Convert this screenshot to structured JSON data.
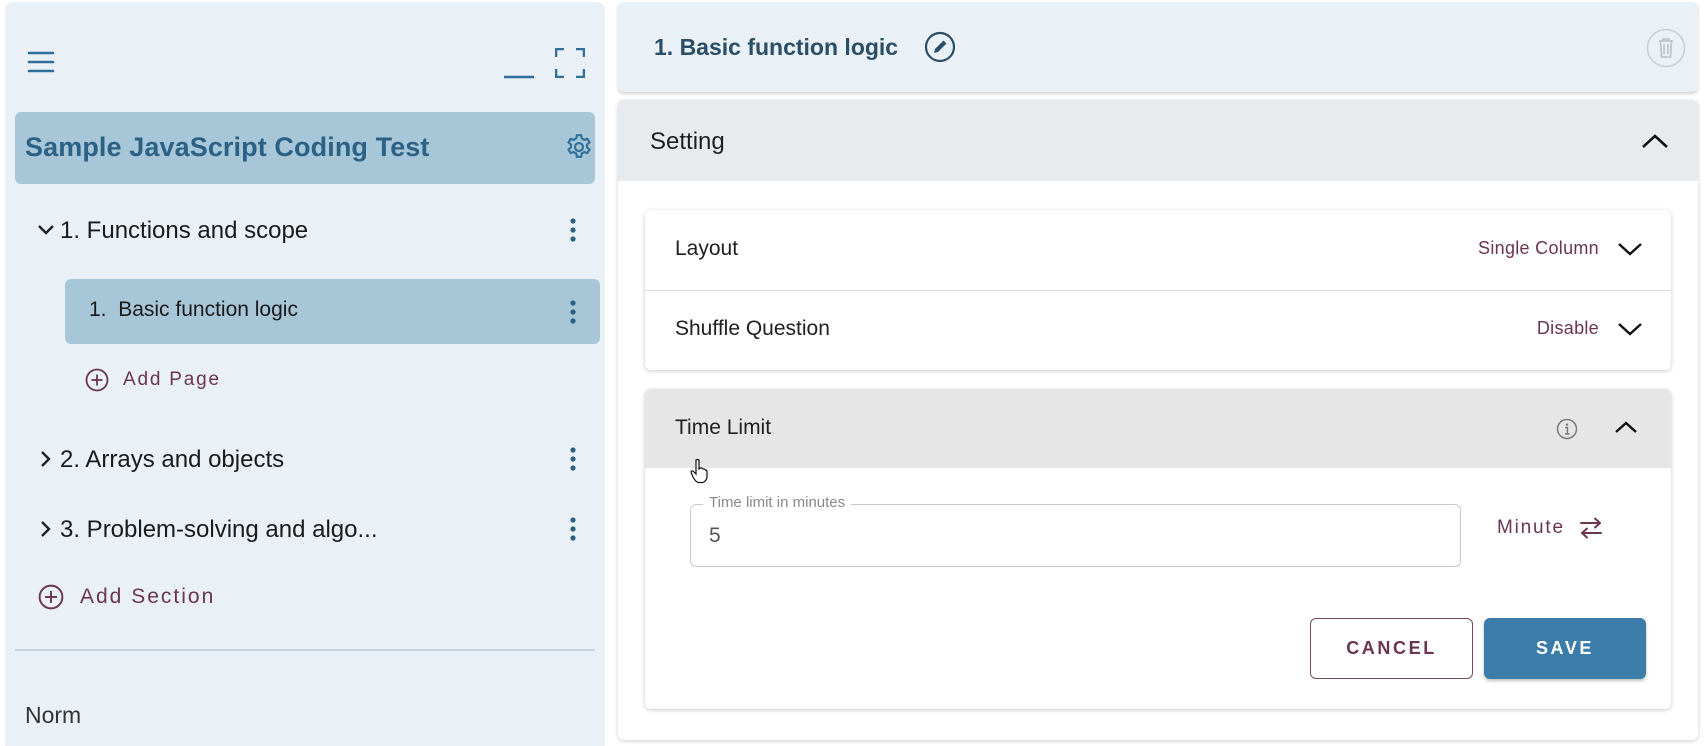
{
  "sidebar": {
    "test_title": "Sample JavaScript Coding Test",
    "sections": [
      {
        "label": "1. Functions and scope",
        "expanded": true
      },
      {
        "label": "2. Arrays and objects",
        "expanded": false
      },
      {
        "label": "3. Problem-solving and algo...",
        "expanded": false
      }
    ],
    "pages": [
      {
        "number": "1.",
        "label": "Basic function logic",
        "selected": true
      }
    ],
    "add_page_label": "Add Page",
    "add_section_label": "Add Section",
    "footer_text": "Norm"
  },
  "page": {
    "title": "1. Basic function logic"
  },
  "setting": {
    "title": "Setting",
    "options": [
      {
        "label": "Layout",
        "value": "Single Column"
      },
      {
        "label": "Shuffle Question",
        "value": "Disable"
      }
    ],
    "time_limit": {
      "label": "Time Limit",
      "field_label": "Time limit in minutes",
      "field_value": "5",
      "unit_label": "Minute"
    },
    "cancel_label": "CANCEL",
    "save_label": "SAVE"
  },
  "colors": {
    "accent": "#3b7ca8",
    "sidebar_bg": "#eaf1f6",
    "selected_bg": "#a7c6d8",
    "secondary_text": "#6b3552",
    "title_blue": "#2a6185"
  },
  "icons": [
    "menu-icon",
    "minimize-icon",
    "fullscreen-icon",
    "gear-icon",
    "chevron-down-icon",
    "chevron-right-icon",
    "kebab-icon",
    "add-circle-icon",
    "edit-icon",
    "delete-icon",
    "chevron-up-icon",
    "info-icon",
    "swap-icon",
    "hand-cursor-icon"
  ]
}
